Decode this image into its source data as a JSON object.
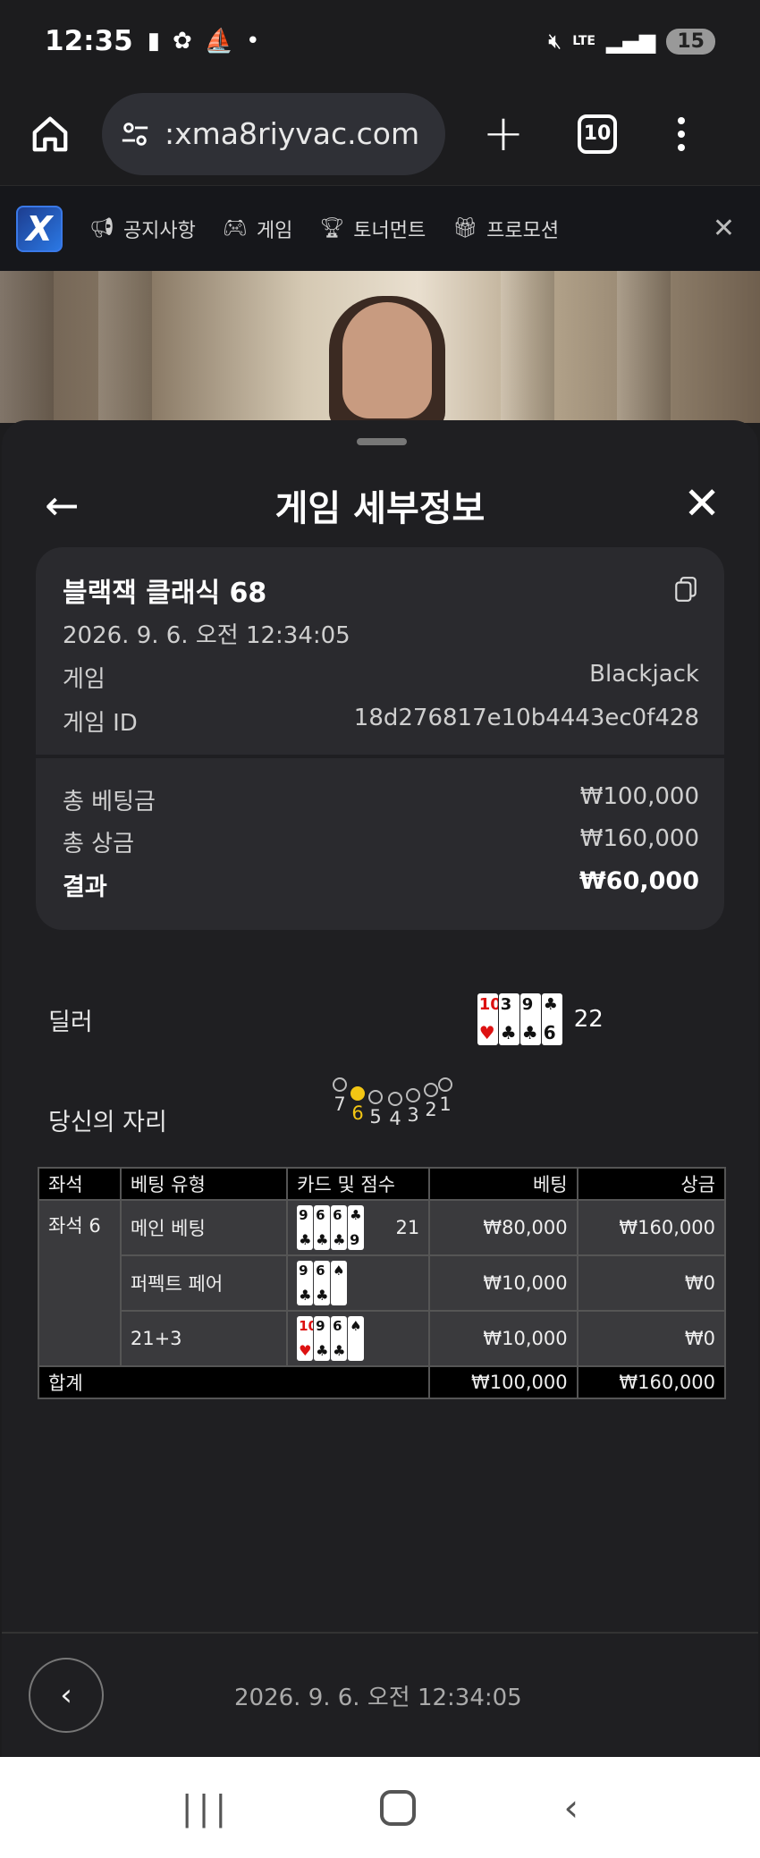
{
  "status_bar": {
    "time": "12:35",
    "network": "LTE",
    "battery": "15",
    "battery_level_percent": 15
  },
  "browser": {
    "url": ":xma8riyvac.com",
    "tab_count": "10"
  },
  "site_nav": {
    "items": [
      {
        "icon": "megaphone-icon",
        "label": "공지사항"
      },
      {
        "icon": "gamepad-icon",
        "label": "게임"
      },
      {
        "icon": "trophy-icon",
        "label": "토너먼트"
      },
      {
        "icon": "gift-icon",
        "label": "프로모션"
      }
    ]
  },
  "panel": {
    "title": "게임 세부정보",
    "game_name": "블랙잭 클래식 68",
    "game_datetime": "2026. 9. 6. 오전 12:34:05",
    "game_label": "게임",
    "game_value": "Blackjack",
    "game_id_label": "게임 ID",
    "game_id_value": "18d276817e10b4443ec0f428",
    "total_bet_label": "총 베팅금",
    "total_bet_value": "₩100,000",
    "total_win_label": "총 상금",
    "total_win_value": "₩160,000",
    "result_label": "결과",
    "result_value": "₩60,000",
    "dealer_label": "딜러",
    "dealer_cards": [
      {
        "rank": "10",
        "suit": "♥",
        "red": true
      },
      {
        "rank": "3",
        "suit": "♣",
        "red": false
      },
      {
        "rank": "9",
        "suit": "♣",
        "red": false
      },
      {
        "rank": "♣",
        "suit": "6",
        "red": false
      }
    ],
    "dealer_score": "22",
    "your_seat_label": "당신의 자리",
    "seats": [
      "7",
      "6",
      "5",
      "4",
      "3",
      "2",
      "1"
    ],
    "active_seat": "6",
    "table": {
      "headers": [
        "좌석",
        "베팅 유형",
        "카드 및 점수",
        "베팅",
        "상금"
      ],
      "seat_name": "좌석 6",
      "rows": [
        {
          "type": "메인 베팅",
          "cards": [
            {
              "rank": "9",
              "suit": "♣",
              "red": false
            },
            {
              "rank": "6",
              "suit": "♣",
              "red": false
            },
            {
              "rank": "6",
              "suit": "♣",
              "red": false
            },
            {
              "rank": "♣",
              "suit": "9",
              "red": false
            }
          ],
          "score": "21",
          "bet": "₩80,000",
          "win": "₩160,000"
        },
        {
          "type": "퍼펙트 페어",
          "cards": [
            {
              "rank": "9",
              "suit": "♣",
              "red": false
            },
            {
              "rank": "6",
              "suit": "♣",
              "red": false
            },
            {
              "rank": "♠",
              "suit": "",
              "red": false
            }
          ],
          "score": "",
          "bet": "₩10,000",
          "win": "₩0"
        },
        {
          "type": "21+3",
          "cards": [
            {
              "rank": "10",
              "suit": "♥",
              "red": true
            },
            {
              "rank": "9",
              "suit": "♣",
              "red": false
            },
            {
              "rank": "6",
              "suit": "♣",
              "red": false
            },
            {
              "rank": "♠",
              "suit": "",
              "red": false
            }
          ],
          "score": "",
          "bet": "₩10,000",
          "win": "₩0"
        }
      ],
      "total_label": "합계",
      "total_bet": "₩100,000",
      "total_win": "₩160,000"
    },
    "footer_date": "2026. 9. 6. 오전 12:34:05"
  }
}
